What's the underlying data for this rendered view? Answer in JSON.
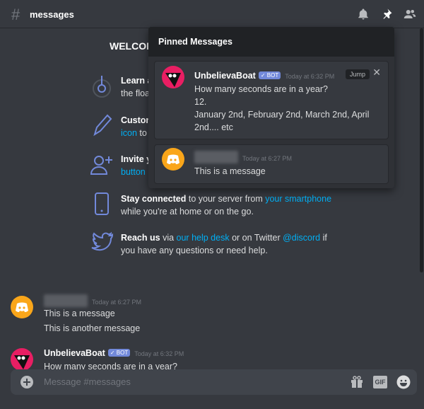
{
  "header": {
    "channel_icon": "hash-icon",
    "channel_name": "messages",
    "icons": [
      "bell-icon",
      "pin-icon",
      "members-icon"
    ]
  },
  "welcome": {
    "title": "WELCOM",
    "items": [
      {
        "icon": "compass-icon",
        "line1_bold": "Learn a",
        "line2": "the floa"
      },
      {
        "icon": "pencil-icon",
        "line1_bold": "Custon",
        "line2_link": "icon",
        "line2": " to"
      },
      {
        "icon": "add-user-icon",
        "line1_bold": "Invite y",
        "line2_link": "button"
      },
      {
        "icon": "phone-icon",
        "line1_bold": "Stay connected",
        "line1": " to your server from ",
        "line1_link": "your smartphone",
        "line2": "while you're at home or on the go."
      },
      {
        "icon": "twitter-icon",
        "line1_bold": "Reach us",
        "line1_a": " via ",
        "line1_link": "our help desk",
        "line1_b": " or on Twitter ",
        "line1_link2": "@discord",
        "line1_c": " if",
        "line2": "you have any questions or need help."
      }
    ]
  },
  "pinned": {
    "title": "Pinned Messages",
    "messages": [
      {
        "author": "UnbelievaBoat",
        "badge": "✓ BOT",
        "time": "Today at 6:32 PM",
        "lines": [
          "How many seconds are in a year?",
          "12.",
          "January 2nd, February 2nd, March 2nd, April",
          "2nd.... etc"
        ],
        "jump": "Jump",
        "close": "✕"
      },
      {
        "author_blurred": true,
        "time": "Today at 6:27 PM",
        "lines": [
          "This is a message"
        ]
      }
    ]
  },
  "chat": [
    {
      "author_blurred": true,
      "time": "Today at 6:27 PM",
      "lines": [
        "This is a message",
        "This is another message"
      ]
    },
    {
      "author": "UnbelievaBoat",
      "badge": "✓ BOT",
      "time": "Today at 6:32 PM",
      "lines": [
        "How many seconds are in a year?"
      ]
    }
  ],
  "composer": {
    "placeholder": "Message #messages",
    "gif": "GIF",
    "icons": [
      "add-icon",
      "gift-icon",
      "gif-icon",
      "emoji-icon"
    ]
  },
  "colors": {
    "background": "#36393f",
    "accent": "#7289da",
    "link": "#00aff4",
    "discord_avatar": "#faa61a",
    "bot_avatar": "#e91e63"
  }
}
